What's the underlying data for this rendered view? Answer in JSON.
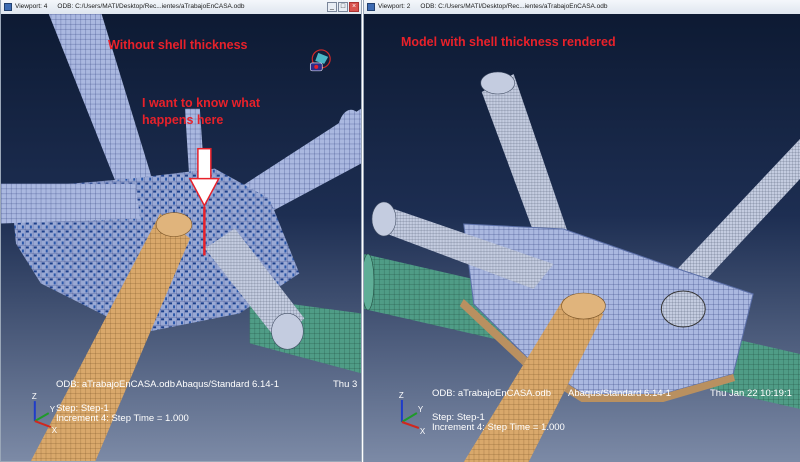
{
  "viewports": [
    {
      "name": "Viewport: 4",
      "odb_path": "ODB: C:/Users/MATI/Desktop/Rec...ientes/aTrabajoEnCASA.odb",
      "annotation_title": "Without shell thickness",
      "annotation_question": "I want to know what\nhappens here",
      "info_odb": "ODB: aTrabajoEnCASA.odb",
      "info_solver": "Abaqus/Standard 6.14-1",
      "info_date": "Thu 3",
      "info_step": "Step: Step-1",
      "info_increment": "Increment     4: Step Time =    1.000",
      "axis_labels": [
        "Z",
        "Y",
        "X"
      ]
    },
    {
      "name": "Viewport: 2",
      "odb_path": "ODB: C:/Users/MATI/Desktop/Rec...ientes/aTrabajoEnCASA.odb",
      "annotation_title": "Model with shell thickness rendered",
      "info_odb": "ODB: aTrabajoEnCASA.odb",
      "info_solver": "Abaqus/Standard 6.14-1",
      "info_date": "Thu Jan 22 10:19:1",
      "info_step": "Step: Step-1",
      "info_increment": "Increment     4: Step Time =    1.000",
      "axis_labels": [
        "Z",
        "Y",
        "X"
      ]
    }
  ],
  "window_buttons": [
    "_",
    "□",
    "×"
  ],
  "colors": {
    "mesh_blue": "#aab8e0",
    "mesh_lines": "#2b3a7a",
    "beam_tan": "#d9a86b",
    "pipe_green": "#4f9c86",
    "annotation_red": "#e8212a",
    "background_top": "#0d1a33",
    "background_bottom": "#7c8aa6"
  }
}
